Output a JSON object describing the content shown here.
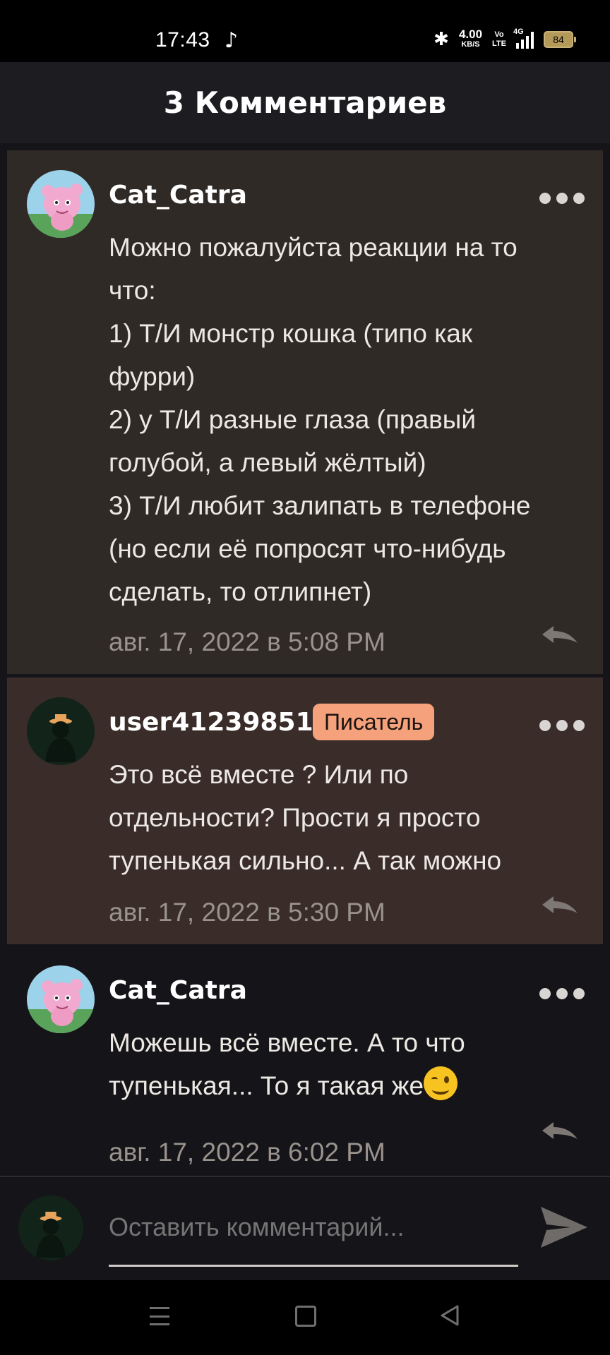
{
  "status_bar": {
    "time": "17:43",
    "speed_value": "4.00",
    "speed_unit": "KB/S",
    "volte_top": "Vo",
    "volte_bottom": "LTE",
    "network": "4G",
    "battery": "84"
  },
  "header": {
    "title": "3 Комментариев"
  },
  "comments": [
    {
      "username": "Cat_Catra",
      "badge": "",
      "text": "Можно пожалуйста реакции на то\nчто:\n1) Т/И монстр кошка (типо как\nфурри)\n2) у Т/И разные глаза (правый\nголубой, а левый жёлтый)\n3) Т/И любит залипать в телефоне\n(но если её попросят что-нибудь\nсделать, то отлипнет)",
      "date": "авг. 17, 2022 в 5:08 PM"
    },
    {
      "username": "user41239851",
      "badge": "Писатель",
      "text": "Это всё вместе ? Или по\nотдельности? Прости я просто\nтупенькая сильно... А так можно",
      "date": "авг. 17, 2022 в 5:30 PM"
    },
    {
      "username": "Cat_Catra",
      "badge": "",
      "text_line1": "Можешь всё вместе. А то что",
      "text_line2": "тупенькая... То я такая же",
      "date": "авг. 17, 2022 в 6:02 PM"
    }
  ],
  "composer": {
    "placeholder": "Оставить комментарий..."
  },
  "icons": {
    "more": "more-dots-icon",
    "reply": "reply-arrow-icon",
    "send": "send-icon",
    "emoji": "wink-emoji-icon"
  },
  "colors": {
    "badge_bg": "#f5a27c",
    "comment1_bg": "#302a26",
    "comment2_bg": "#3a2c28",
    "page_bg": "#151418"
  }
}
